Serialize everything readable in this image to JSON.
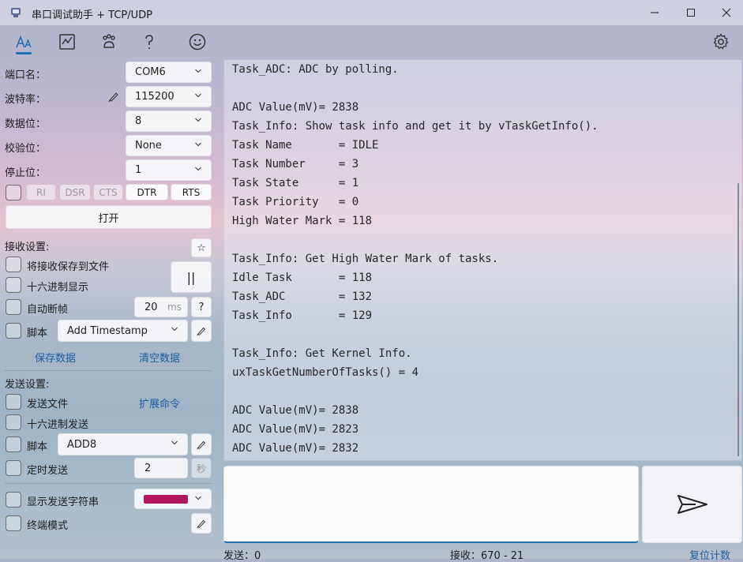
{
  "window": {
    "title": "串口调试助手 + TCP/UDP"
  },
  "icons": {
    "app": "serial-port-icon",
    "font": "font-size-icon",
    "chart": "chart-icon",
    "pets": "paw-icon",
    "help": "question-icon",
    "emoji": "smiley-icon",
    "settings": "gear-icon"
  },
  "colors": {
    "accent": "#1f6fb5",
    "link": "#1b5fa6",
    "send_color_swatch": "#b3185f"
  },
  "serial": {
    "port_label": "端口名：",
    "port_value": "COM6",
    "baud_label": "波特率：",
    "baud_value": "115200",
    "databits_label": "数据位：",
    "databits_value": "8",
    "parity_label": "校验位：",
    "parity_value": "None",
    "stopbits_label": "停止位：",
    "stopbits_value": "1",
    "signals": [
      "RI",
      "DSR",
      "CTS",
      "DTR",
      "RTS"
    ],
    "open_label": "打开"
  },
  "receive": {
    "section_label": "接收设置:",
    "save_to_file": "将接收保存到文件",
    "hex_display": "十六进制显示",
    "auto_frame": "自动断帧",
    "frame_ms": "20",
    "frame_unit": "ms",
    "help_label": "?",
    "script_label": "脚本",
    "script_value": "Add Timestamp",
    "save_data": "保存数据",
    "clear_data": "清空数据",
    "pause_label": "||",
    "pin_label": "☆"
  },
  "send": {
    "section_label": "发送设置:",
    "send_file": "发送文件",
    "ext_command": "扩展命令",
    "hex_send": "十六进制发送",
    "script_label": "脚本",
    "script_value": "ADD8",
    "timed_send": "定时发送",
    "timer_value": "2",
    "timer_unit": "秒",
    "show_send_string": "显示发送字符串",
    "terminal_mode": "终端模式"
  },
  "terminal": {
    "lines": [
      "Task_ADC: ADC by polling.",
      "",
      "ADC Value(mV)= 2838",
      "Task_Info: Show task info and get it by vTaskGetInfo().",
      "Task Name       = IDLE",
      "Task Number     = 3",
      "Task State      = 1",
      "Task Priority   = 0",
      "High Water Mark = 118",
      "",
      "Task_Info: Get High Water Mark of tasks.",
      "Idle Task       = 118",
      "Task_ADC        = 132",
      "Task_Info       = 129",
      "",
      "Task_Info: Get Kernel Info.",
      "uxTaskGetNumberOfTasks() = 4",
      "",
      "ADC Value(mV)= 2838",
      "ADC Value(mV)= 2823",
      "ADC Value(mV)= 2832"
    ]
  },
  "status": {
    "sent": "发送：0",
    "received": "接收：670 - 21",
    "reset": "复位计数"
  }
}
